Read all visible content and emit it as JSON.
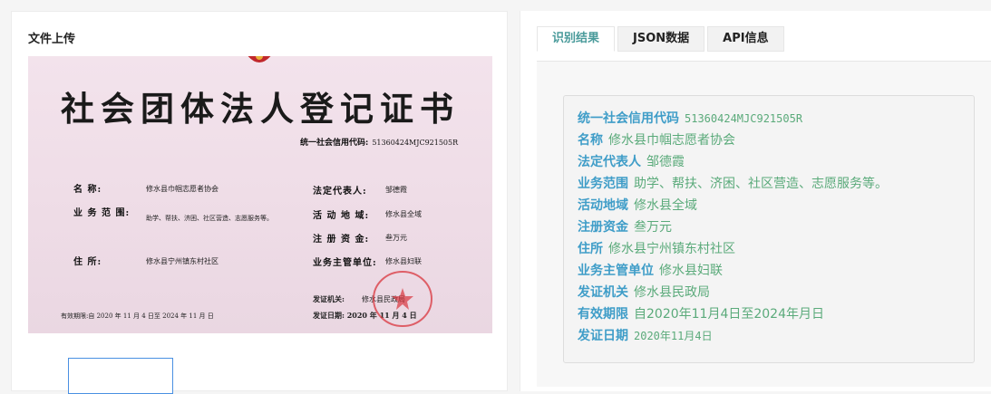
{
  "upload": {
    "title": "文件上传"
  },
  "certificate": {
    "title": "社会团体法人登记证书",
    "code_label": "统一社会信用代码:",
    "code_value": "51360424MJC921505R",
    "name_label": "名      称:",
    "name_value": "修水县巾帼志愿者协会",
    "scope_label": "业 务 范 围:",
    "scope_value": "助学、帮扶、济困、社区营造、志愿服务等。",
    "address_label": "住      所:",
    "address_value": "修水县宁州镇东村社区",
    "rep_label": "法定代表人:",
    "rep_value": "邹德霞",
    "area_label": "活 动 地 域:",
    "area_value": "修水县全域",
    "capital_label": "注 册 资 金:",
    "capital_value": "叁万元",
    "org_label": "业务主管单位:",
    "org_value": "修水县妇联",
    "issuer_label": "发证机关:",
    "issuer_value": "修水县民政局",
    "validity_text": "有效期限:自  2020 年 11 月 4 日至  2024 年 11 月  日",
    "date_text": "发证日期:  2020  年 11 月  4  日",
    "seal_text": "修水县民政局"
  },
  "tabs": [
    {
      "label": "识别结果",
      "active": true
    },
    {
      "label": "JSON数据",
      "active": false
    },
    {
      "label": "API信息",
      "active": false
    }
  ],
  "results": [
    {
      "key": "统一社会信用代码",
      "value": "51360424MJC921505R",
      "mono": true
    },
    {
      "key": "名称",
      "value": "修水县巾帼志愿者协会"
    },
    {
      "key": "法定代表人",
      "value": "邹德霞"
    },
    {
      "key": "业务范围",
      "value": "助学、帮扶、济困、社区营造、志愿服务等。"
    },
    {
      "key": "活动地域",
      "value": "修水县全域"
    },
    {
      "key": "注册资金",
      "value": "叁万元"
    },
    {
      "key": "住所",
      "value": "修水县宁州镇东村社区"
    },
    {
      "key": "业务主管单位",
      "value": "修水县妇联"
    },
    {
      "key": "发证机关",
      "value": "修水县民政局"
    },
    {
      "key": "有效期限",
      "value": "自2020年11月4日至2024年月日"
    },
    {
      "key": "发证日期",
      "value": "2020年11月4日",
      "mono": true
    }
  ],
  "colors": {
    "accent_tab": "#4a9b9b",
    "result_key": "#3f9dc8",
    "result_value": "#5aaa7a",
    "seal_red": "#d9363e"
  }
}
